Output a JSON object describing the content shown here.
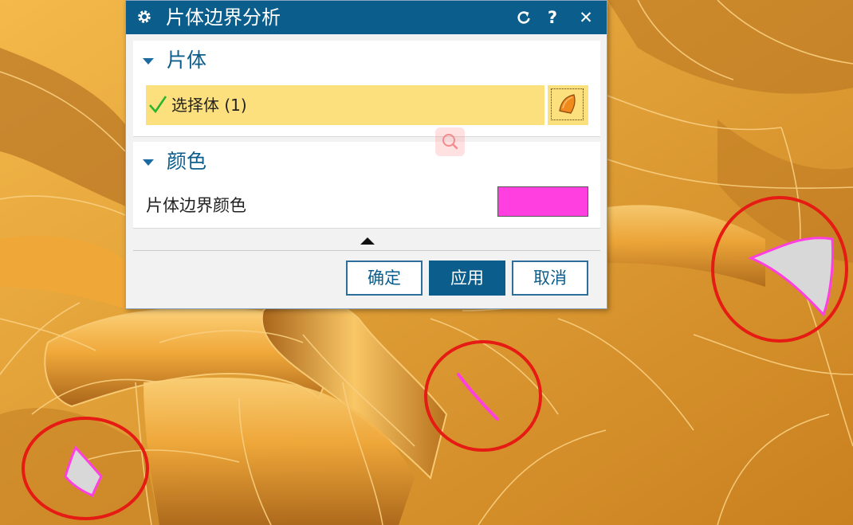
{
  "dialog": {
    "title": "片体边界分析",
    "title_icon": "gear-icon",
    "controls": {
      "reset_icon": "reset-icon",
      "help_label": "?",
      "close_label": "✕"
    }
  },
  "sections": {
    "sheet_body": {
      "header": "片体",
      "select_label": "选择体 (1)",
      "select_icon": "sheet-body-icon",
      "check_icon": "checkmark-icon"
    },
    "color": {
      "header": "颜色",
      "boundary_color_label": "片体边界颜色",
      "boundary_color": "#ff3fe0"
    }
  },
  "footer": {
    "ok_label": "确定",
    "apply_label": "应用",
    "cancel_label": "取消"
  },
  "colors": {
    "title_bar": "#0b5e8c",
    "highlight": "#fde07e",
    "model": "#e9a236",
    "annotation_circle": "#e51b14",
    "sheet_fill": "#d8d8d8",
    "check": "#2ab530"
  }
}
